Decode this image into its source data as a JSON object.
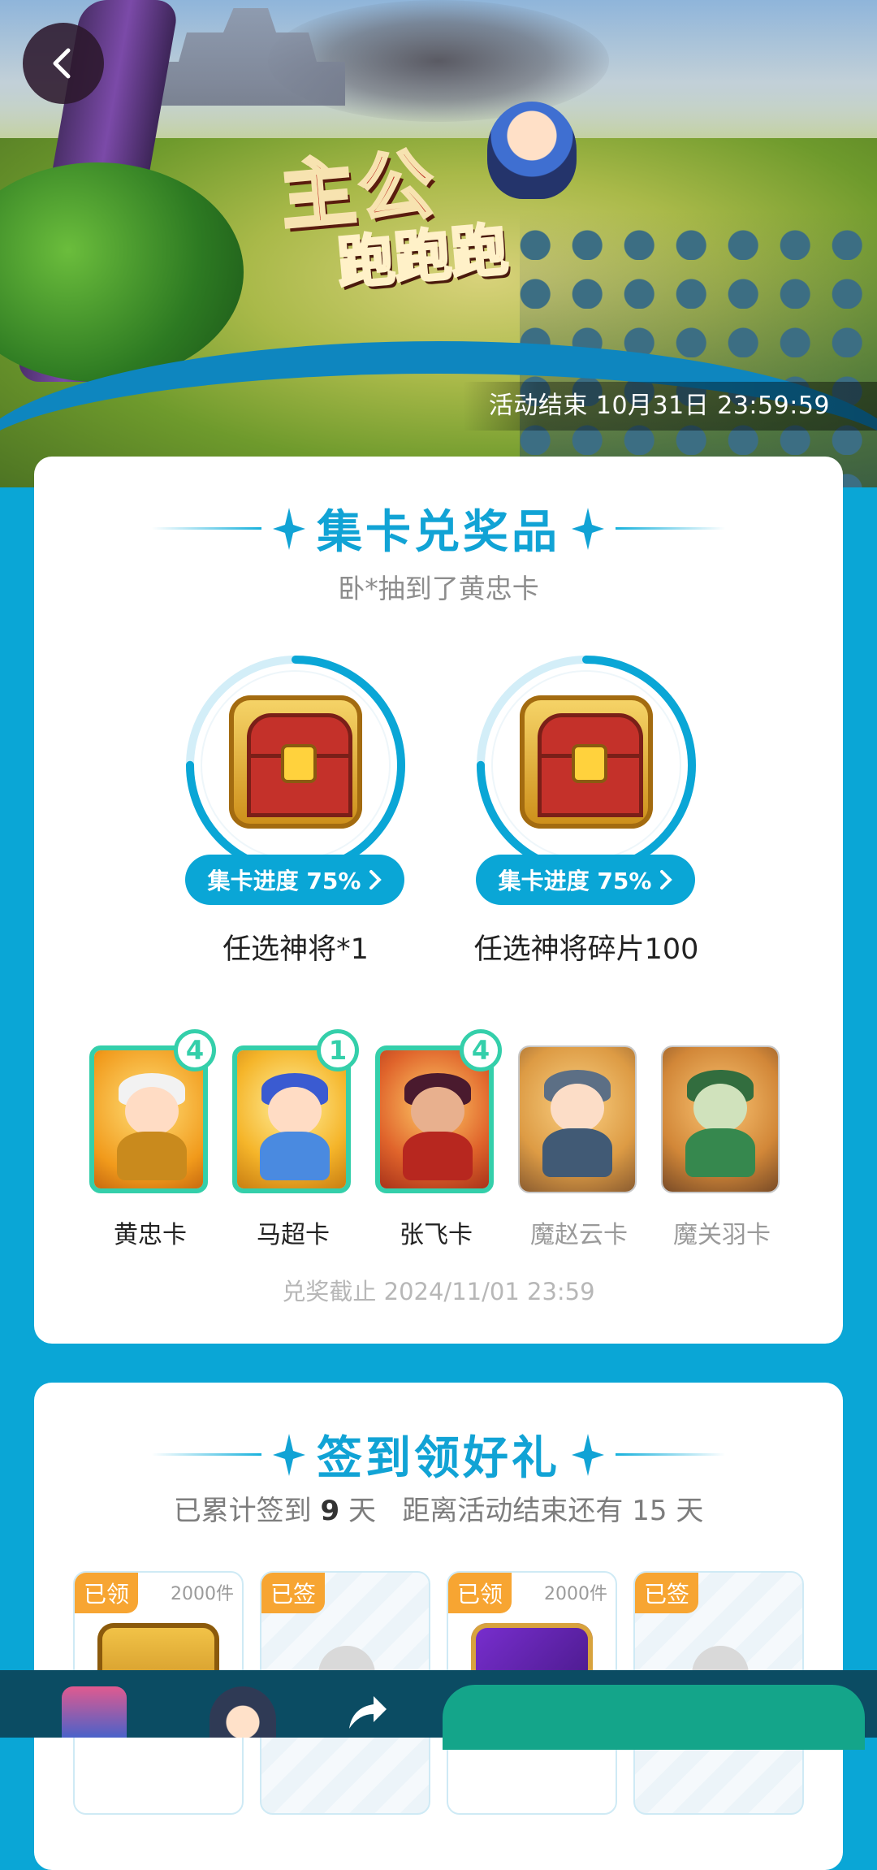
{
  "header": {
    "event_end": "活动结束 10月31日 23:59:59",
    "banner_title_line1": "主公",
    "banner_title_line2": "跑跑跑"
  },
  "collect": {
    "title": "集卡兑奖品",
    "ticker": "卧*抽到了黄忠卡",
    "prizes": [
      {
        "progress_label": "集卡进度 75%",
        "progress": 0.75,
        "name": "任选神将*1",
        "icon": "treasure-chest-icon"
      },
      {
        "progress_label": "集卡进度 75%",
        "progress": 0.75,
        "name": "任选神将碎片100",
        "icon": "treasure-chest-icon"
      }
    ],
    "cards": [
      {
        "name": "黄忠卡",
        "count": "4",
        "owned": true
      },
      {
        "name": "马超卡",
        "count": "1",
        "owned": true
      },
      {
        "name": "张飞卡",
        "count": "4",
        "owned": true
      },
      {
        "name": "魔赵云卡",
        "count": "",
        "owned": false
      },
      {
        "name": "魔关羽卡",
        "count": "",
        "owned": false
      }
    ],
    "deadline": "兑奖截止 2024/11/01 23:59"
  },
  "signin": {
    "title": "签到领好礼",
    "days_label_prefix": "已累计签到",
    "days_value": "9",
    "days_unit": "天",
    "remaining_prefix": "距离活动结束还有",
    "remaining_value": "15",
    "remaining_unit": "天",
    "days": [
      {
        "tag": "已领",
        "count": "2000件"
      },
      {
        "tag": "已签",
        "count": ""
      },
      {
        "tag": "已领",
        "count": "2000件"
      },
      {
        "tag": "已签",
        "count": ""
      }
    ]
  },
  "colors": {
    "page_bg": "#0aa6d6",
    "accent": "#11a3d5",
    "owned_border": "#34cfaa",
    "tag_orange": "#f7a532"
  }
}
